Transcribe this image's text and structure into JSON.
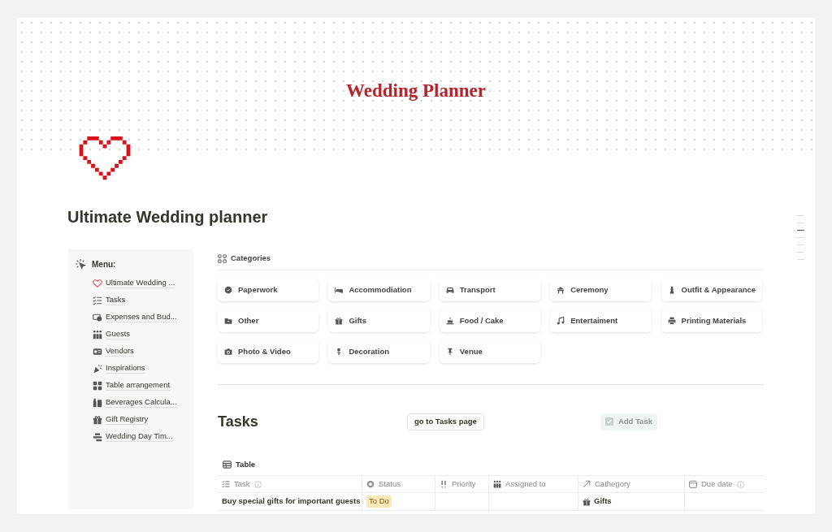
{
  "cover_title": "Wedding Planner",
  "page_title": "Ultimate Wedding planner",
  "menu": {
    "label": "Menu:",
    "items": [
      {
        "label": "Ultimate Wedding ..."
      },
      {
        "label": "Tasks"
      },
      {
        "label": "Expenses and Bud..."
      },
      {
        "label": "Guests"
      },
      {
        "label": "Vendors"
      },
      {
        "label": "Inspirations"
      },
      {
        "label": "Table arrangement"
      },
      {
        "label": "Beverages Calcula..."
      },
      {
        "label": "Gift Registry"
      },
      {
        "label": "Wedding Day Tim..."
      }
    ]
  },
  "categories": {
    "label": "Categories",
    "items": [
      {
        "label": "Paperwork"
      },
      {
        "label": "Accommodiation"
      },
      {
        "label": "Transport"
      },
      {
        "label": "Ceremony"
      },
      {
        "label": "Outfit & Appearance"
      },
      {
        "label": "Other"
      },
      {
        "label": "Gifts"
      },
      {
        "label": "Food / Cake"
      },
      {
        "label": "Entertaiment"
      },
      {
        "label": "Printing Materials"
      },
      {
        "label": "Photo & Video"
      },
      {
        "label": "Decoration"
      },
      {
        "label": "Venue"
      }
    ]
  },
  "tasks": {
    "heading": "Tasks",
    "link_button": "go to Tasks page",
    "add_button": {
      "label": "Add Task",
      "disabled": true
    }
  },
  "table": {
    "view": "Table",
    "columns": [
      {
        "label": "Task",
        "info": true
      },
      {
        "label": "Status",
        "info": false
      },
      {
        "label": "Priority",
        "info": false
      },
      {
        "label": "Assigned to",
        "info": false
      },
      {
        "label": "Cathegory",
        "info": false
      },
      {
        "label": "Due date",
        "info": true
      }
    ],
    "rows": [
      {
        "task": "Buy special gifts for important guests",
        "status": "To Do",
        "category": "Gifts"
      }
    ]
  }
}
